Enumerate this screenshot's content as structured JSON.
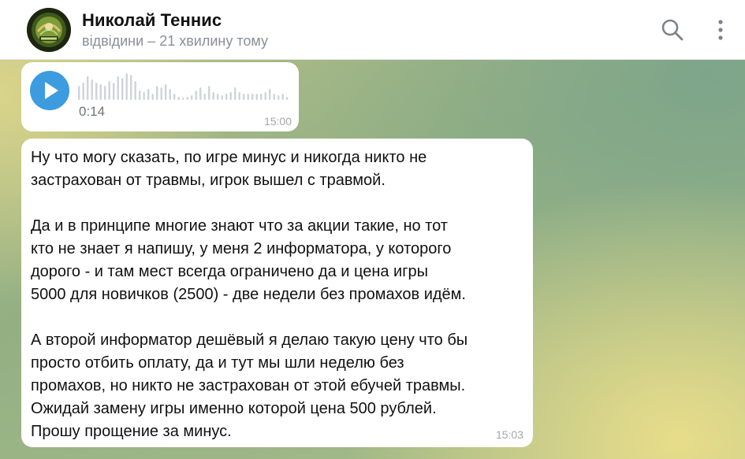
{
  "header": {
    "title": "Николай Теннис",
    "status": "відвідини – 21 хвилину тому",
    "avatar_icon": "tennis-club-logo-icon",
    "search_icon": "search-icon",
    "menu_icon": "more-vertical-icon"
  },
  "voice_message": {
    "play_icon": "play-icon",
    "duration": "0:14",
    "time": "15:00"
  },
  "text_message": {
    "lines": [
      "Ну что могу сказать, по игре минус и никогда никто не",
      "застрахован от травмы, игрок вышел с травмой.",
      "",
      "Да и в принципе многие знают что за акции такие, но тот",
      "кто не знает я напишу, у меня 2 информатора, у которого",
      "дорого - и там мест всегда ограничено да и цена игры",
      "5000 для новичков (2500) - две недели без промахов идём.",
      "",
      "А второй информатор дешёвый я делаю такую цену что бы",
      "просто отбить оплату, да и тут мы шли неделю без",
      "промахов, но никто не застрахован от этой ебучей травмы.",
      "Ожидай замену игры именно которой цена 500 рублей.",
      "Прошу прощение за минус."
    ],
    "time": "15:03"
  },
  "colors": {
    "accent": "#3d9be0",
    "bubble": "#ffffff",
    "header_bg": "#ffffff",
    "status_text": "#8a8f96",
    "time_text": "#a3a8ad"
  }
}
